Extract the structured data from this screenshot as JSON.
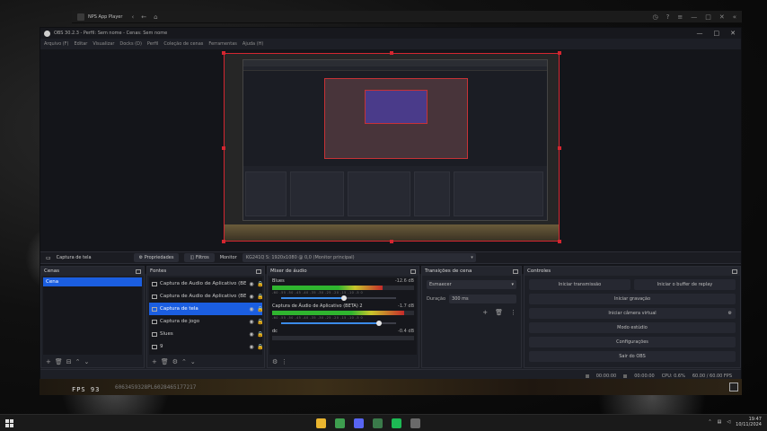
{
  "player": {
    "title": "NPS App Player",
    "nav": [
      "‹",
      "←",
      "⌂"
    ],
    "controls": [
      "◷",
      "?",
      "≡",
      "—",
      "□",
      "✕",
      "«"
    ]
  },
  "obs": {
    "title": "OBS 30.2.3 - Perfil: Sem nome - Cenas: Sem nome",
    "window_controls": [
      "—",
      "□",
      "✕"
    ],
    "menu": [
      "Arquivo (F)",
      "Editar",
      "Visualizar",
      "Docks (D)",
      "Perfil",
      "Coleção de cenas",
      "Ferramentas",
      "Ajuda (H)"
    ],
    "source_bar": {
      "source_name": "Captura de tela",
      "properties": "Propriedades",
      "filters": "Filtros",
      "monitor_label": "Monitor",
      "monitor_value": "KG241Q S: 1920x1080 @ 0,0 (Monitor principal)"
    },
    "scenes": {
      "title": "Cenas",
      "items": [
        {
          "label": "Cena",
          "selected": true
        }
      ]
    },
    "sources": {
      "title": "Fontes",
      "items": [
        {
          "label": "Captura de Áudio de Aplicativo (BE",
          "selected": false
        },
        {
          "label": "Captura de Áudio de Aplicativo (BE",
          "selected": false
        },
        {
          "label": "Captura de tela",
          "selected": true
        },
        {
          "label": "Captura de jogo",
          "selected": false
        },
        {
          "label": "Slues",
          "selected": false
        },
        {
          "label": "9",
          "selected": false
        }
      ]
    },
    "mixer": {
      "title": "Mixer de áudio",
      "channels": [
        {
          "name": "Blues",
          "db": "-12.6 dB",
          "level": 0.78,
          "volume": 0.55
        },
        {
          "name": "Captura de Áudio de Aplicativo (BETA) 2",
          "db": "-1.7 dB",
          "level": 0.93,
          "volume": 0.85
        },
        {
          "name": "dc",
          "db": "-0.4 dB",
          "level": 0.0,
          "volume": 0.0
        }
      ],
      "scale": "-60 -55 -50 -45 -40 -35 -30 -25 -20 -15 -10 -5 0"
    },
    "transitions": {
      "title": "Transições de cena",
      "type": "Esmaecer",
      "duration_label": "Duração",
      "duration": "300 ms"
    },
    "controls": {
      "title": "Controles",
      "buttons": [
        "Iniciar transmissão",
        "Iniciar gravação",
        "Iniciar câmera virtual",
        "Modo estúdio",
        "Configurações",
        "Sair do OBS"
      ],
      "replay_buffer": "Iniciar o buffer de replay"
    },
    "status": {
      "time1": "00:00:00",
      "time2": "00:00:00",
      "cpu": "CPU: 0.6%",
      "fps": "60.00 / 60.00 FPS"
    }
  },
  "game": {
    "fps": "FPS 93",
    "seed": "6063459328PL6028465177217"
  },
  "taskbar": {
    "time": "19:47",
    "date": "10/11/2024",
    "apps": [
      {
        "name": "file-explorer-icon",
        "color": "#e9b52f"
      },
      {
        "name": "chrome-icon",
        "color": "#3e9e4f"
      },
      {
        "name": "discord-icon",
        "color": "#5865f2"
      },
      {
        "name": "terminal-icon",
        "color": "#3a7a4a"
      },
      {
        "name": "spotify-icon",
        "color": "#1db954"
      },
      {
        "name": "obs-icon",
        "color": "#6a6a6a"
      }
    ]
  }
}
